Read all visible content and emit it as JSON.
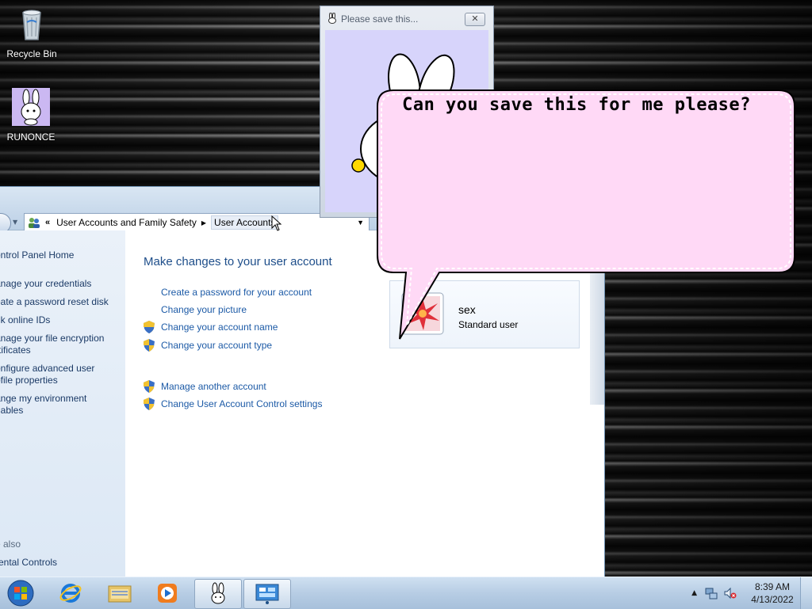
{
  "desktop": {
    "icons": [
      {
        "label": "Recycle Bin",
        "icon": "recycle-bin-icon"
      },
      {
        "label": "RUNONCE",
        "icon": "bunny-icon"
      }
    ]
  },
  "explorer": {
    "address": {
      "crumb_chevron": "«",
      "crumb1": "User Accounts and Family Safety",
      "crumb2": "User Accounts"
    },
    "left_pane": {
      "items": [
        "ontrol Panel Home",
        "anage your credentials",
        "eate a password reset disk",
        "nk online IDs",
        "anage your file encryption",
        "rtificates",
        "onfigure advanced user",
        "ofile properties",
        "ange my environment",
        "riables"
      ],
      "see_also_heading": "e also",
      "see_also_items": [
        "rental Controls"
      ]
    },
    "main": {
      "title": "Make changes to your user account",
      "tasks": [
        {
          "label": "Create a password for your account",
          "shield": false
        },
        {
          "label": "Change your picture",
          "shield": false
        },
        {
          "label": "Change your account name",
          "shield": true
        },
        {
          "label": "Change your account type",
          "shield": true
        }
      ],
      "other_tasks": [
        {
          "label": "Manage another account",
          "shield": true
        },
        {
          "label": "Change User Account Control settings",
          "shield": true
        }
      ],
      "account": {
        "name": "sex",
        "type": "Standard user"
      }
    }
  },
  "bunny_window": {
    "title": "Please save this...",
    "close_glyph": "✕"
  },
  "speech_bubble": {
    "text": "Can you save this for me please?"
  },
  "taskbar": {
    "buttons": [
      "start-orb",
      "internet-explorer",
      "windows-explorer",
      "media-player",
      "bunny-app",
      "control-panel"
    ],
    "clock": {
      "time": "8:39 AM",
      "date": "4/13/2022"
    },
    "colors": {
      "accent": "#1c5aa6",
      "bubble": "#ffd9f6",
      "bunny_client": "#d7d4fb"
    }
  }
}
